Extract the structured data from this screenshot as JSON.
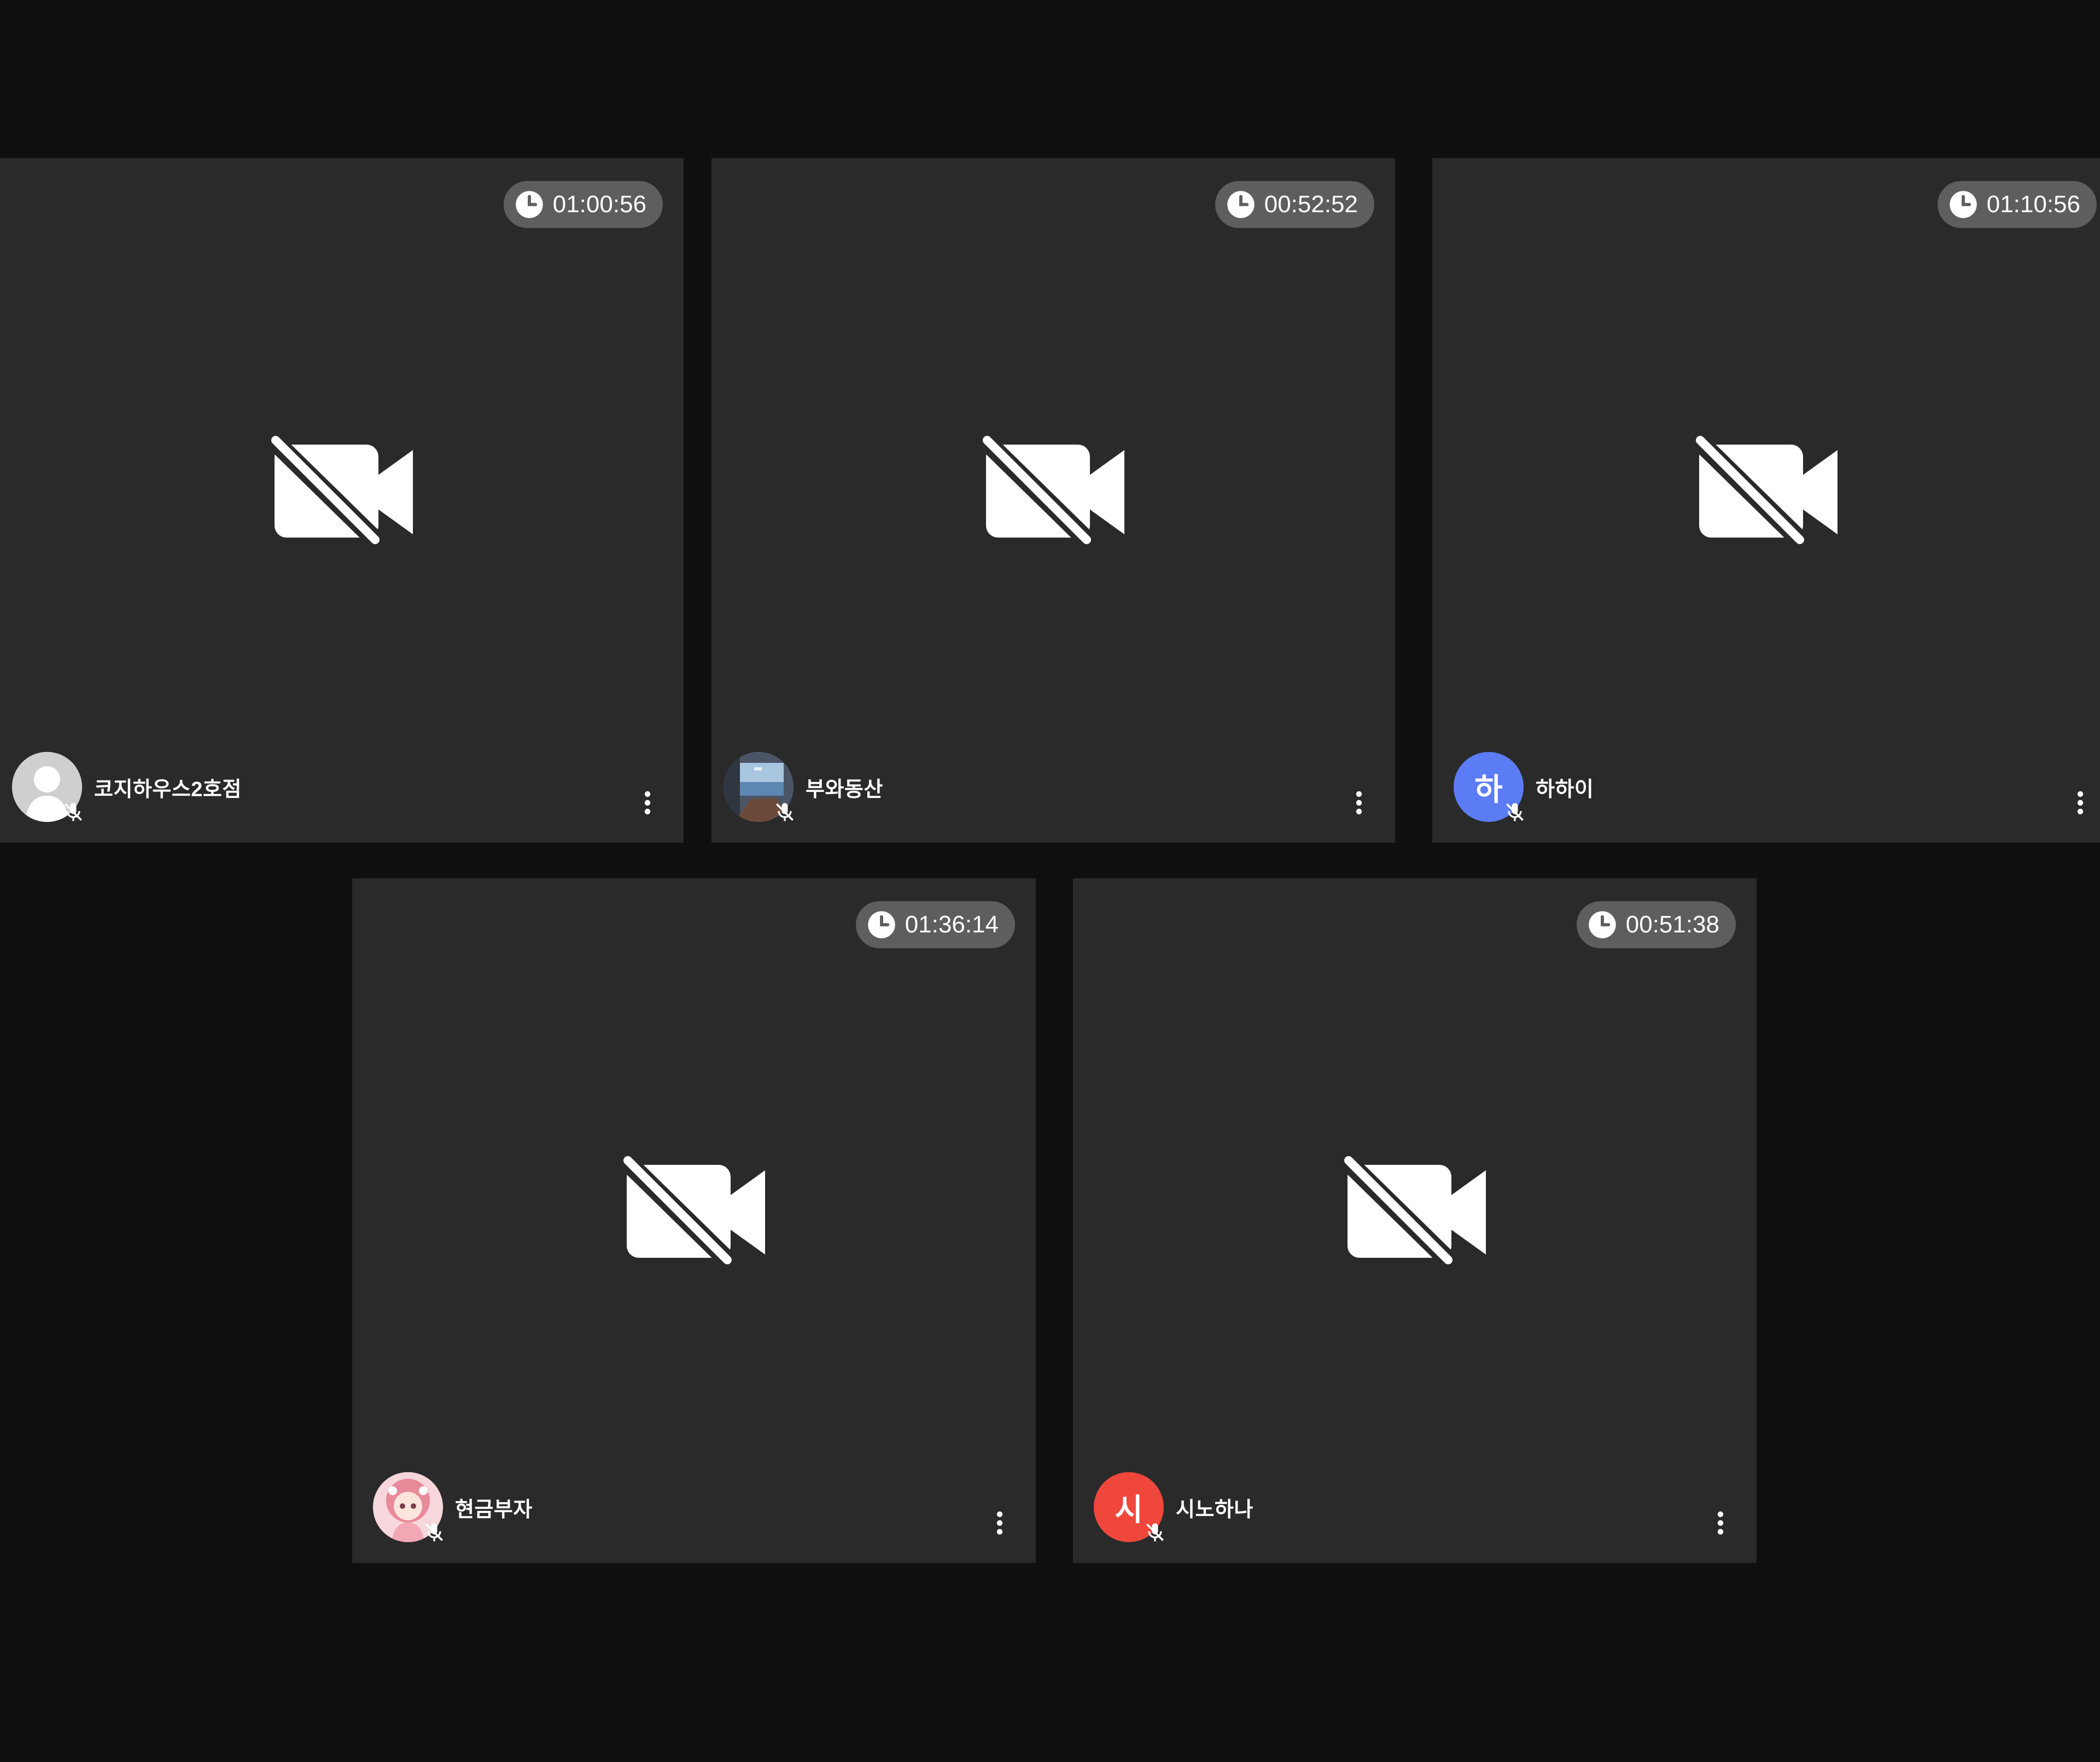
{
  "colors": {
    "background": "#0f0f0f",
    "tile": "#2a2a2a",
    "timer_pill": "#5e5e5e",
    "icon": "#ffffff"
  },
  "participants": [
    {
      "name": "코지하우스2호점",
      "timer": "01:00:56",
      "avatar": {
        "type": "default-user-photo",
        "initial": ""
      }
    },
    {
      "name": "부와동산",
      "timer": "00:52:52",
      "avatar": {
        "type": "photo-scenery",
        "initial": ""
      }
    },
    {
      "name": "하하이",
      "timer": "01:10:56",
      "avatar": {
        "type": "initial",
        "initial": "하",
        "color": "#5b7cf5"
      }
    },
    {
      "name": "현금부자",
      "timer": "01:36:14",
      "avatar": {
        "type": "photo-anime",
        "initial": ""
      }
    },
    {
      "name": "시노하나",
      "timer": "00:51:38",
      "avatar": {
        "type": "initial",
        "initial": "시",
        "color": "#f0473c"
      }
    }
  ]
}
